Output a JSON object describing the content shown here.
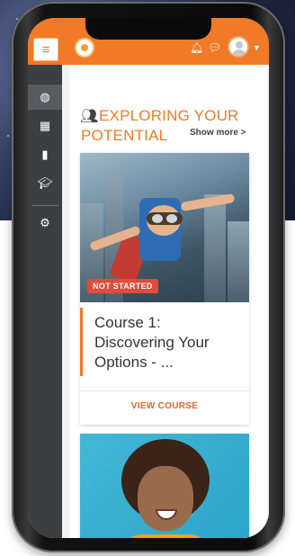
{
  "header": {
    "menu_icon": "hamburger-icon",
    "notifications_icon": "bell-icon",
    "messages_icon": "chat-icon"
  },
  "sidebar": {
    "items": [
      {
        "icon": "dashboard-icon"
      },
      {
        "icon": "calendar-icon"
      },
      {
        "icon": "file-icon"
      },
      {
        "icon": "graduation-cap-icon"
      },
      {
        "icon": "cogs-icon"
      }
    ]
  },
  "section": {
    "icon": "users-icon",
    "title": "EXPLORING YOUR POTENTIAL",
    "show_more": "Show more >"
  },
  "courses": [
    {
      "badge": "NOT STARTED",
      "title": "Course 1: Discovering Your Options - ...",
      "action": "VIEW COURSE"
    }
  ],
  "colors": {
    "brand": "#f07a26",
    "sidebar": "#3b3f42",
    "badge": "#e24b3b"
  }
}
